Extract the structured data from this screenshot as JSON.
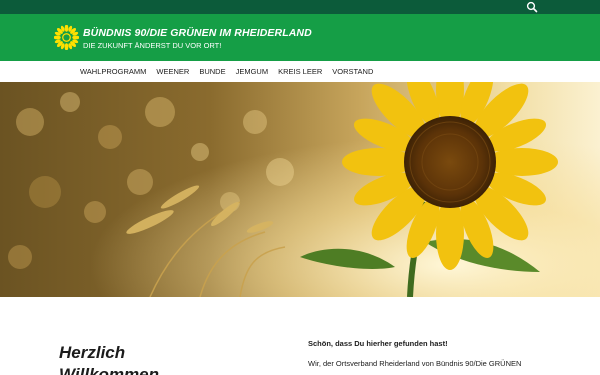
{
  "topbar": {
    "search_icon": "search-icon"
  },
  "header": {
    "logo_icon": "sunflower-logo-icon",
    "title": "BÜNDNIS 90/DIE GRÜNEN IM RHEIDERLAND",
    "tagline": "DIE ZUKUNFT ÄNDERST DU VOR ORT!"
  },
  "nav": {
    "items": [
      {
        "label": "WAHLPROGRAMM"
      },
      {
        "label": "WEENER"
      },
      {
        "label": "BUNDE"
      },
      {
        "label": "JEMGUM"
      },
      {
        "label": "KREIS LEER"
      },
      {
        "label": "VORSTAND"
      }
    ]
  },
  "hero": {
    "description": "sunflower-and-wheat-image"
  },
  "content": {
    "welcome_heading": "Herzlich Willkommen",
    "intro_heading": "Schön, dass Du hierher gefunden hast!",
    "intro_text": "Wir, der Ortsverband Rheiderland von Bündnis 90/Die GRÜNEN"
  },
  "colors": {
    "topbar": "#0c5b3a",
    "header": "#159e46",
    "text": "#1c1c1c"
  }
}
